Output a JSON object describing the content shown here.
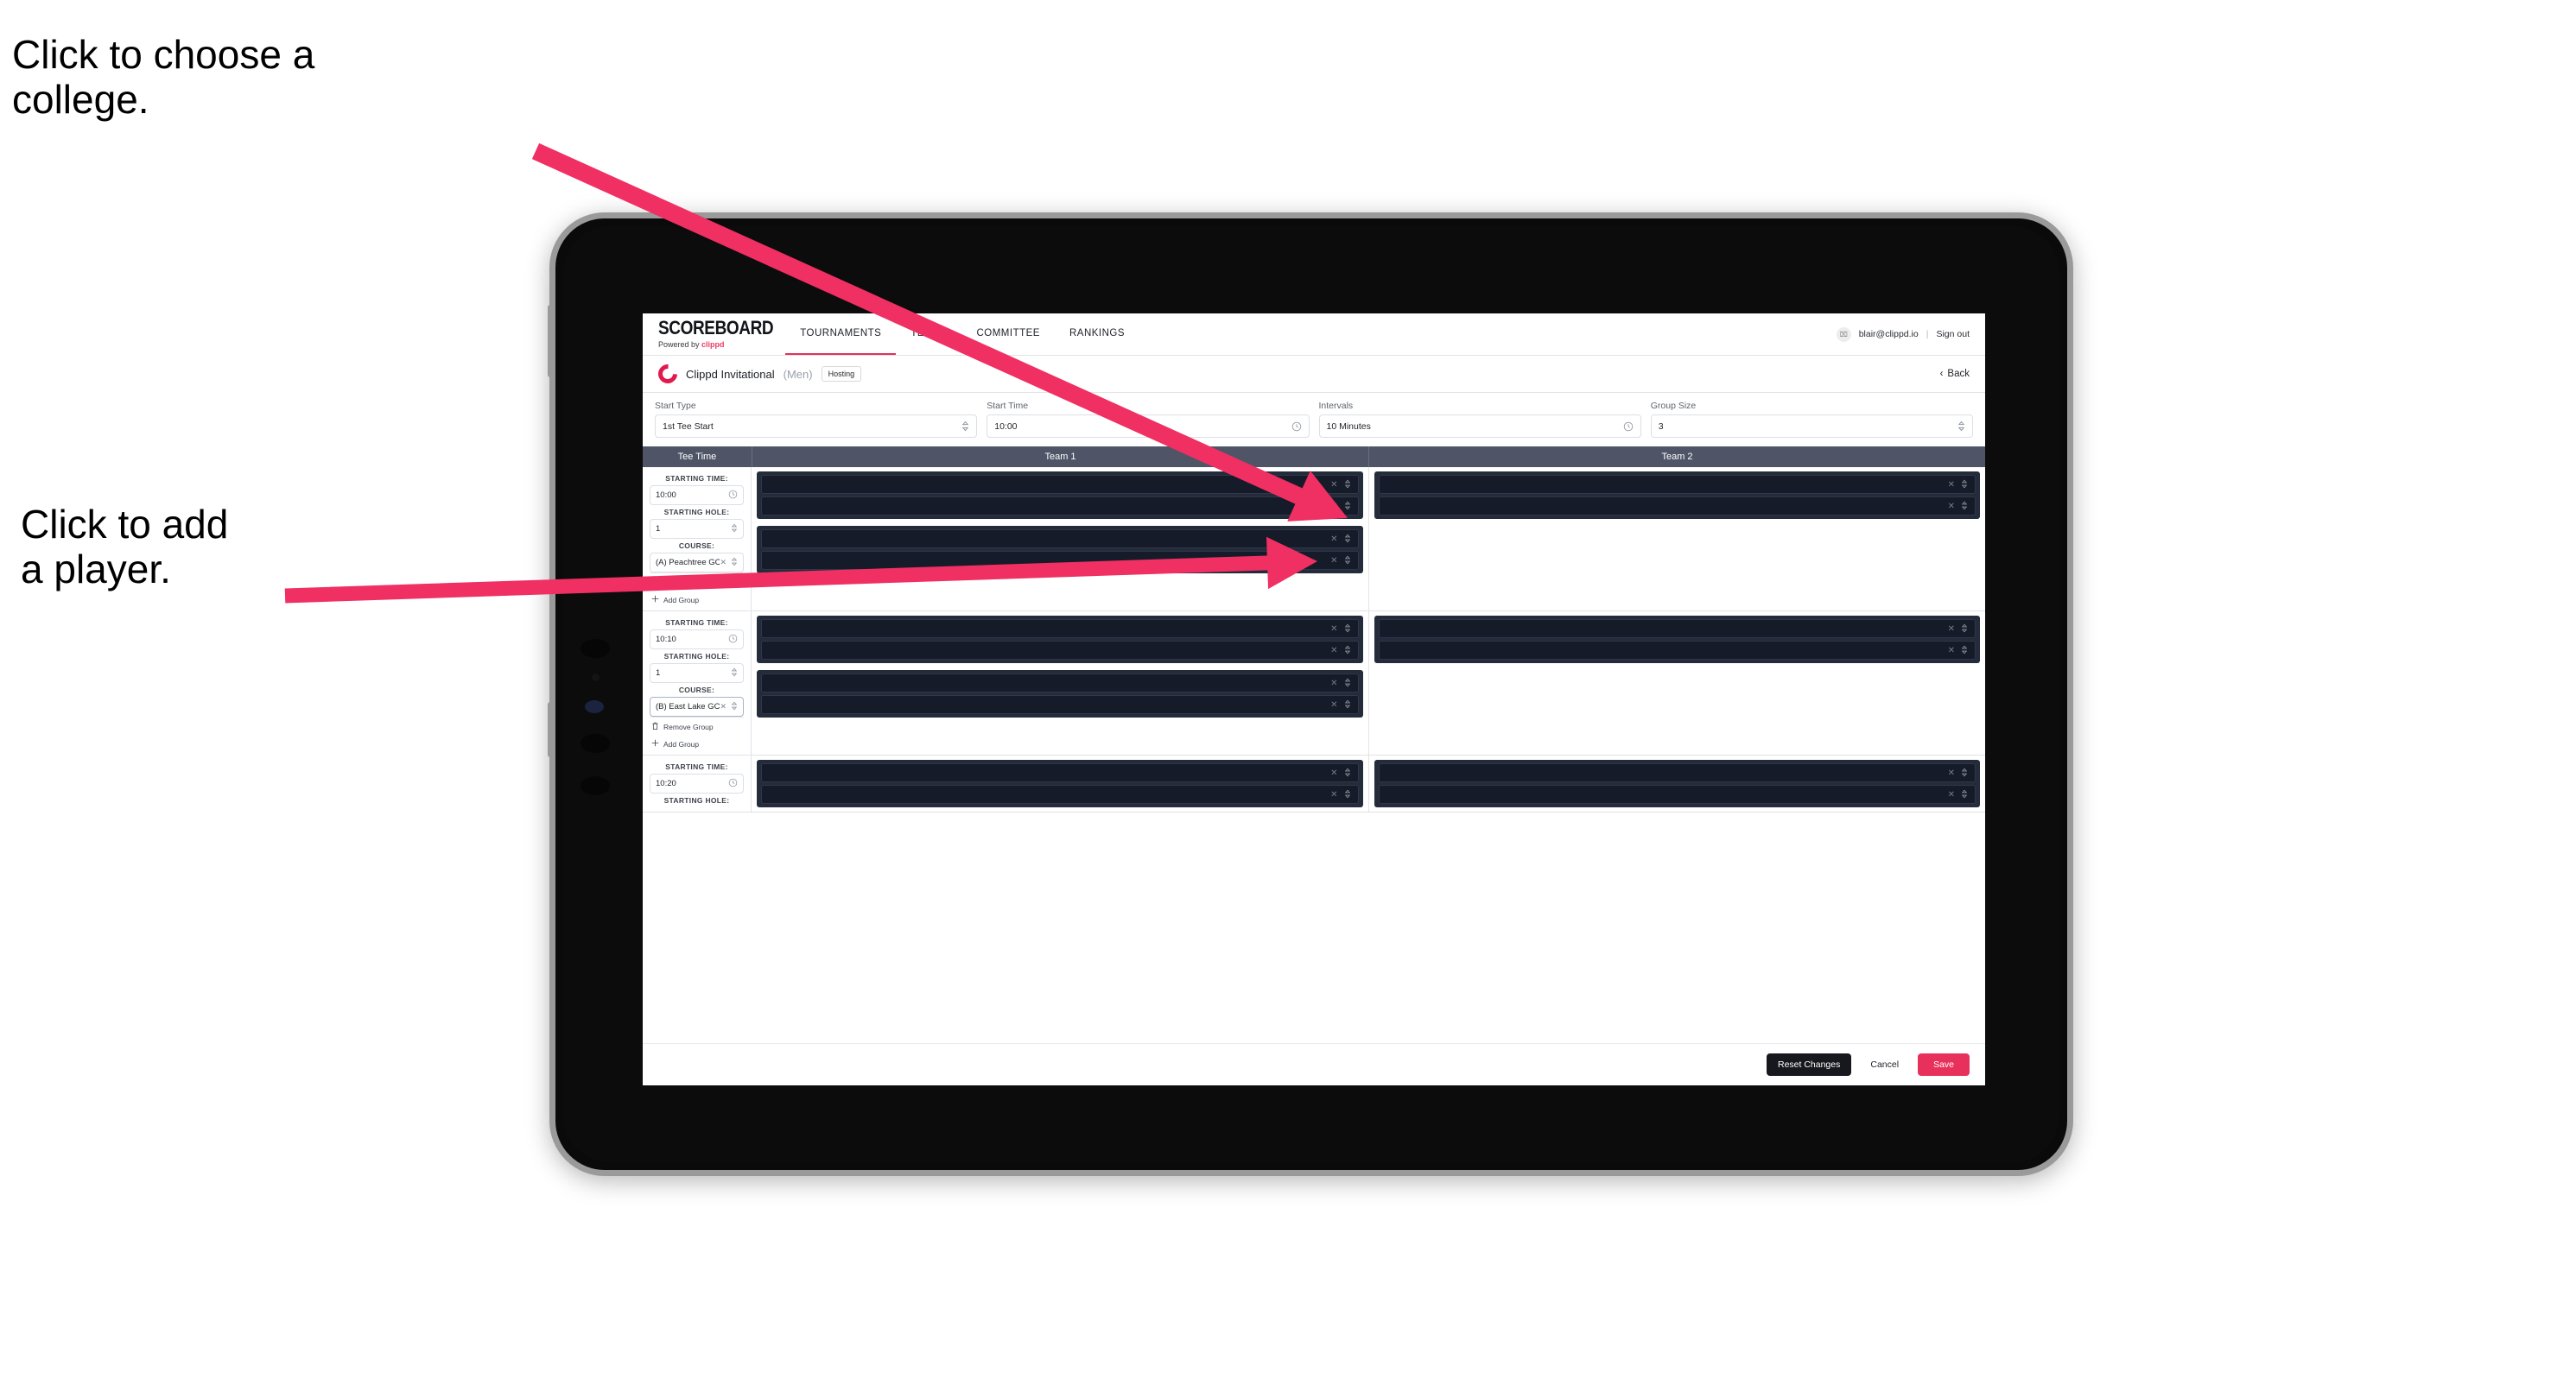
{
  "annotations": {
    "college": "Click to choose a\ncollege.",
    "player": "Click to add\na player.",
    "arrow_color": "#F02F63"
  },
  "topnav": {
    "brand_main": "SCOREBOARD",
    "brand_sub_prefix": "Powered by ",
    "brand_sub_name": "clippd",
    "links": [
      {
        "label": "TOURNAMENTS",
        "active": true
      },
      {
        "label": "TEAMS",
        "active": false
      },
      {
        "label": "COMMITTEE",
        "active": false
      },
      {
        "label": "RANKINGS",
        "active": false
      }
    ],
    "avatar_glyph": "⌧",
    "user_email": "blair@clippd.io",
    "separator": "|",
    "sign_out": "Sign out"
  },
  "tournament_bar": {
    "logo_name": "clippd-c-logo",
    "name": "Clippd Invitational",
    "gender": "(Men)",
    "badge": "Hosting",
    "back_chevron": "‹",
    "back_label": "Back"
  },
  "settings": {
    "fields": [
      {
        "label": "Start Type",
        "value": "1st Tee Start",
        "icon": "stepper-icon",
        "glyph": "⌃⌄"
      },
      {
        "label": "Start Time",
        "value": "10:00",
        "icon": "clock-icon",
        "glyph": "◴"
      },
      {
        "label": "Intervals",
        "value": "10 Minutes",
        "icon": "clock-icon",
        "glyph": "◴"
      },
      {
        "label": "Group Size",
        "value": "3",
        "icon": "stepper-icon",
        "glyph": "⌃⌄"
      }
    ]
  },
  "table": {
    "headers": {
      "tee_time": "Tee Time",
      "team1": "Team 1",
      "team2": "Team 2"
    },
    "labels": {
      "starting_time": "STARTING TIME:",
      "starting_hole": "STARTING HOLE:",
      "course": "COURSE:",
      "remove_group": "Remove Group",
      "add_group": "Add Group",
      "trash_glyph": "☐",
      "plus_glyph": "+",
      "clock_glyph": "◴",
      "stepper_glyph": "⌃⌄",
      "clear_glyph": "✕"
    },
    "groups": [
      {
        "starting_time": "10:00",
        "starting_hole": "1",
        "course": "(A) Peachtree GC",
        "course_focused": false,
        "team1_groups": [
          2,
          2
        ],
        "team2_groups": [
          2
        ]
      },
      {
        "starting_time": "10:10",
        "starting_hole": "1",
        "course": "(B) East Lake GC",
        "course_focused": true,
        "team1_groups": [
          2,
          2
        ],
        "team2_groups": [
          2
        ]
      },
      {
        "starting_time": "10:20",
        "starting_hole": "",
        "course": "",
        "course_focused": false,
        "team1_groups": [
          2
        ],
        "team2_groups": [
          2
        ]
      }
    ]
  },
  "footer": {
    "reset_label": "Reset Changes",
    "cancel_label": "Cancel",
    "save_label": "Save",
    "save_color": "#E8305C"
  }
}
